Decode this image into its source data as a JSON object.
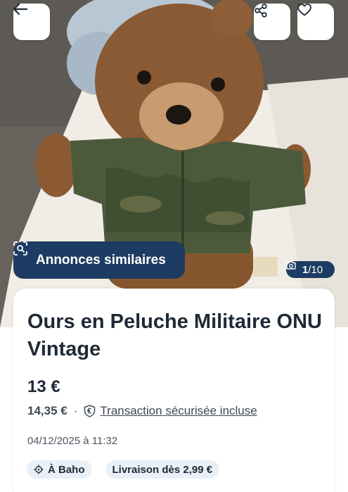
{
  "nav": {
    "back_icon": "arrow-left-icon",
    "share_icon": "share-icon",
    "favorite_icon": "heart-icon"
  },
  "photo": {
    "similar_label": "Annonces similaires",
    "similar_icon": "visual-search-icon",
    "counter_current": "1",
    "counter_total": "/10",
    "counter_icon": "camera-icon"
  },
  "listing": {
    "title": "Ours en Peluche Militaire ONU Vintage",
    "price": "13 €",
    "total_price": "14,35 €",
    "separator": "·",
    "protection_label": "Transaction sécurisée incluse",
    "date": "04/12/2025 à 11:32",
    "location": "À Baho",
    "shipping": "Livraison dès 2,99 €"
  },
  "colors": {
    "navy": "#1d3c63",
    "tag_bg": "#e9f0f8",
    "text": "#1f2a36"
  }
}
